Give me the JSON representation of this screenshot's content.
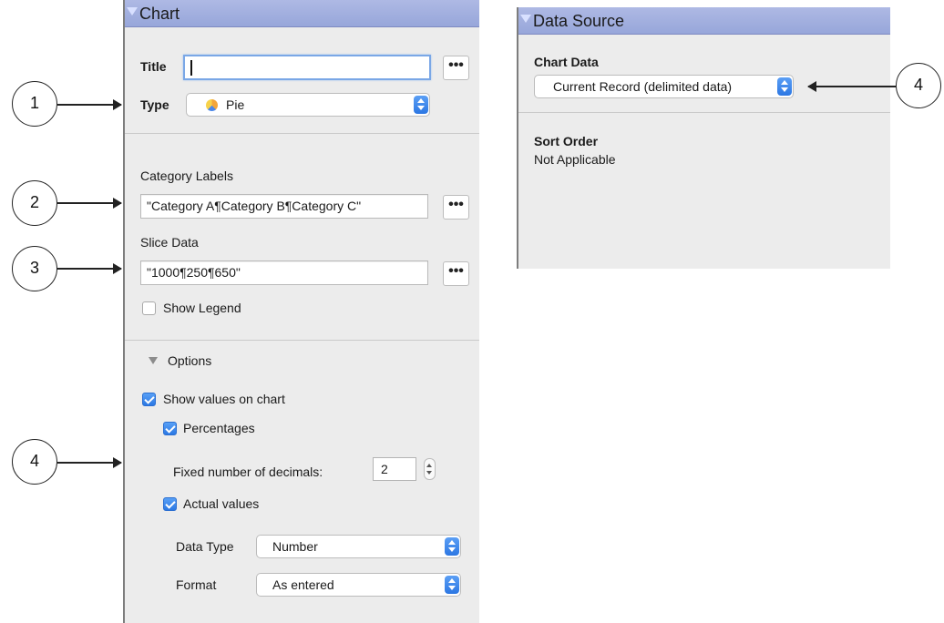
{
  "chart_panel": {
    "header": "Chart",
    "title_label": "Title",
    "title_value": "",
    "more_label": "•••",
    "type_label": "Type",
    "type_value": "Pie",
    "type_icon": "pie-chart-icon",
    "category_labels_label": "Category Labels",
    "category_labels_value": "\"Category A¶Category B¶Category C\"",
    "slice_data_label": "Slice Data",
    "slice_data_value": "\"1000¶250¶650\"",
    "show_legend_label": "Show Legend",
    "show_legend_checked": false,
    "options_label": "Options",
    "show_values_label": "Show values on chart",
    "show_values_checked": true,
    "percentages_label": "Percentages",
    "percentages_checked": true,
    "decimals_label": "Fixed number of decimals:",
    "decimals_value": "2",
    "actual_values_label": "Actual values",
    "actual_values_checked": true,
    "data_type_label": "Data Type",
    "data_type_value": "Number",
    "format_label": "Format",
    "format_value": "As entered"
  },
  "data_source_panel": {
    "header": "Data Source",
    "chart_data_label": "Chart Data",
    "chart_data_value": "Current Record (delimited data)",
    "sort_order_label": "Sort Order",
    "sort_order_value": "Not Applicable"
  },
  "callouts": [
    "1",
    "2",
    "3",
    "4",
    "4"
  ],
  "colors": {
    "header": "#a3b0e0",
    "panel": "#ececec",
    "accent": "#2b78e4"
  }
}
